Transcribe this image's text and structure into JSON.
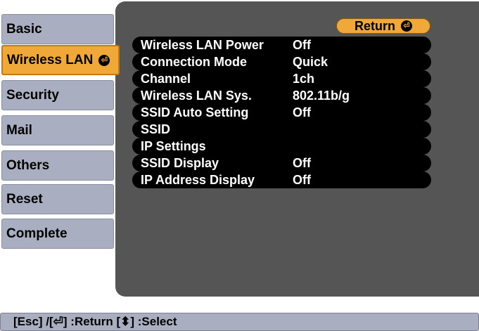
{
  "tabs": [
    {
      "label": "Basic"
    },
    {
      "label": "Wireless LAN",
      "icon": "enter-icon"
    },
    {
      "label": "Security"
    },
    {
      "label": "Mail"
    },
    {
      "label": "Others"
    },
    {
      "label": "Reset"
    },
    {
      "label": "Complete"
    }
  ],
  "return_button": {
    "label": "Return",
    "icon": "enter-icon"
  },
  "rows": [
    {
      "label": "Wireless LAN Power",
      "value": "Off"
    },
    {
      "label": "Connection Mode",
      "value": "Quick"
    },
    {
      "label": "Channel",
      "value": "1ch"
    },
    {
      "label": "Wireless LAN Sys.",
      "value": "802.11b/g"
    },
    {
      "label": "SSID Auto Setting",
      "value": "Off"
    },
    {
      "label": "SSID",
      "value": ""
    },
    {
      "label": "IP Settings",
      "value": ""
    },
    {
      "label": "SSID Display",
      "value": "Off"
    },
    {
      "label": "IP Address Display",
      "value": "Off"
    }
  ],
  "help_bar": {
    "text": "[Esc] /[⏎] :Return  [⬍] :Select"
  },
  "colors": {
    "accent": "#f0a838",
    "tab": "#a9aec0",
    "panel": "#555555",
    "row": "#000000"
  }
}
